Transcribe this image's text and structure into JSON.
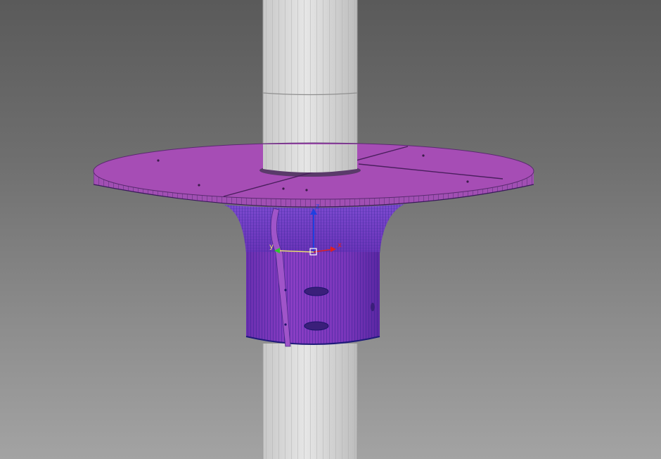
{
  "viewport": {
    "gizmo": {
      "x_axis_label": "x",
      "y_axis_label": "y",
      "z_axis_label": "z"
    }
  },
  "colors": {
    "background_top": "#5a5a5a",
    "background_bottom": "#a3a3a3",
    "pillar": "#dcdcdc",
    "pillar_lines": "#9a9a9a",
    "mesh_body": "#9c44c8",
    "mesh_top": "#a54fb6",
    "mesh_wire": "#2a2a9c",
    "gizmo_x": "#e02020",
    "gizmo_y": "#2ec82e",
    "gizmo_z": "#2040e0",
    "gizmo_center": "#ffd24a"
  }
}
